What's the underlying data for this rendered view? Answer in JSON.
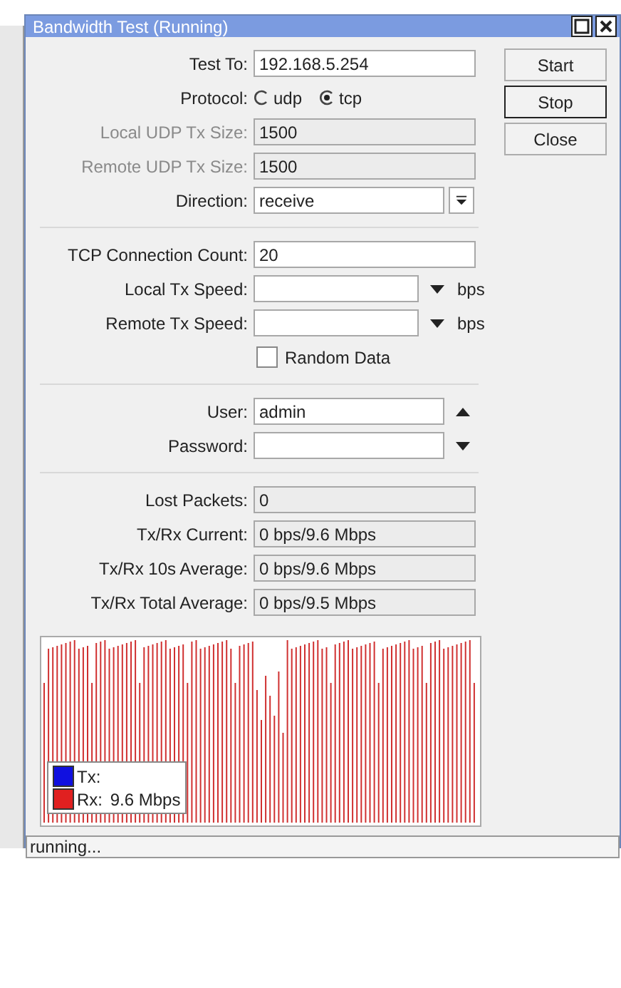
{
  "window": {
    "title": "Bandwidth Test (Running)"
  },
  "form": [
    {
      "kind": "text",
      "label": "Test To:",
      "value": "192.168.5.254",
      "disabled": false
    },
    {
      "kind": "radio",
      "label": "Protocol:",
      "options": [
        {
          "label": "udp",
          "selected": false
        },
        {
          "label": "tcp",
          "selected": true
        }
      ]
    },
    {
      "kind": "text",
      "label": "Local UDP Tx Size:",
      "value": "1500",
      "disabled": true
    },
    {
      "kind": "text",
      "label": "Remote UDP Tx Size:",
      "value": "1500",
      "disabled": true
    },
    {
      "kind": "select",
      "label": "Direction:",
      "value": "receive"
    },
    {
      "kind": "separator"
    },
    {
      "kind": "text",
      "label": "TCP Connection Count:",
      "value": "20",
      "disabled": false
    },
    {
      "kind": "speed",
      "label": "Local Tx Speed:",
      "unit": "bps"
    },
    {
      "kind": "speed",
      "label": "Remote Tx Speed:",
      "unit": "bps"
    },
    {
      "kind": "checkbox",
      "label": "Random Data",
      "checked": false
    },
    {
      "kind": "separator"
    },
    {
      "kind": "combo",
      "label": "User:",
      "value": "admin",
      "caret_up": true
    },
    {
      "kind": "combo",
      "label": "Password:",
      "caret_up": false
    },
    {
      "kind": "separator"
    },
    {
      "kind": "readonly",
      "label": "Lost Packets:",
      "value": "0"
    },
    {
      "kind": "readonly",
      "label": "Tx/Rx Current:",
      "value": "0 bps/9.6 Mbps"
    },
    {
      "kind": "readonly",
      "label": "Tx/Rx 10s Average:",
      "value": "0 bps/9.6 Mbps"
    },
    {
      "kind": "readonly",
      "label": "Tx/Rx Total Average:",
      "value": "0 bps/9.5 Mbps"
    }
  ],
  "buttons": [
    {
      "label": "Start",
      "focused": false
    },
    {
      "label": "Stop",
      "focused": true
    },
    {
      "label": "Close",
      "focused": false
    }
  ],
  "graph": {
    "legend": [
      {
        "label": "Tx:",
        "color": "#1010e0"
      },
      {
        "label": "Rx:",
        "value": "9.6 Mbps",
        "color": "#e02020"
      }
    ]
  },
  "status_bar": {
    "text": "running..."
  }
}
